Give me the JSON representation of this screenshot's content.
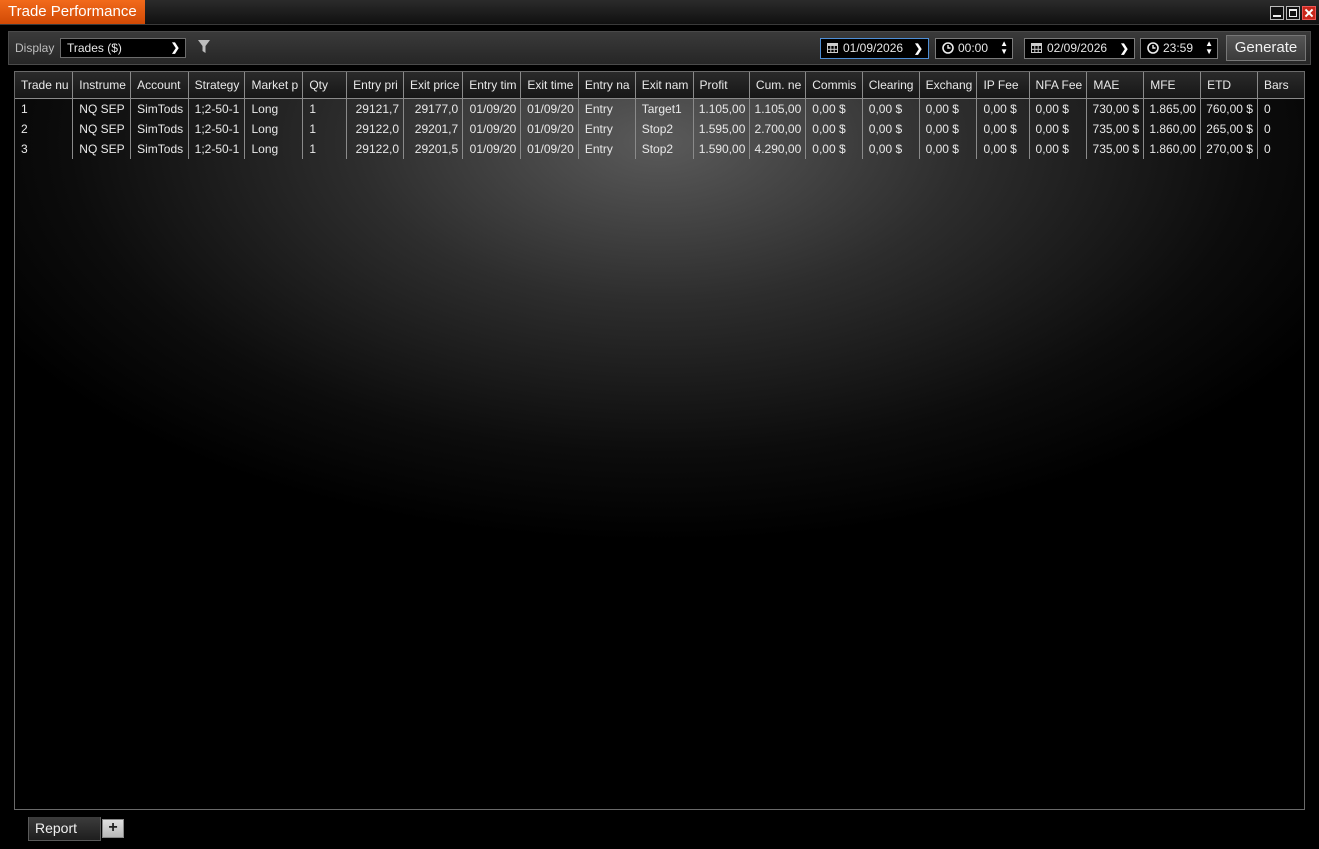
{
  "window": {
    "title": "Trade Performance"
  },
  "toolbar": {
    "display_label": "Display",
    "display_value": "Trades ($)",
    "from_date": "01/09/2026",
    "from_time": "00:00",
    "to_date": "02/09/2026",
    "to_time": "23:59",
    "generate_label": "Generate"
  },
  "grid": {
    "columns": [
      "Trade nu",
      "Instrume",
      "Account",
      "Strategy",
      "Market p",
      "Qty",
      "Entry pri",
      "Exit price",
      "Entry tim",
      "Exit time",
      "Entry na",
      "Exit nam",
      "Profit",
      "Cum. ne",
      "Commis",
      "Clearing",
      "Exchang",
      "IP Fee",
      "NFA Fee",
      "MAE",
      "MFE",
      "ETD",
      "Bars"
    ],
    "rows": [
      [
        "1",
        "NQ SEP",
        "SimTods",
        "1;2-50-1",
        "Long",
        "1",
        "29121,7",
        "29177,0",
        "01/09/20",
        "01/09/20",
        "Entry",
        "Target1",
        "1.105,00",
        "1.105,00",
        "0,00 $",
        "0,00 $",
        "0,00 $",
        "0,00 $",
        "0,00 $",
        "730,00 $",
        "1.865,00",
        "760,00 $",
        "0"
      ],
      [
        "2",
        "NQ SEP",
        "SimTods",
        "1;2-50-1",
        "Long",
        "1",
        "29122,0",
        "29201,7",
        "01/09/20",
        "01/09/20",
        "Entry",
        "Stop2",
        "1.595,00",
        "2.700,00",
        "0,00 $",
        "0,00 $",
        "0,00 $",
        "0,00 $",
        "0,00 $",
        "735,00 $",
        "1.860,00",
        "265,00 $",
        "0"
      ],
      [
        "3",
        "NQ SEP",
        "SimTods",
        "1;2-50-1",
        "Long",
        "1",
        "29122,0",
        "29201,5",
        "01/09/20",
        "01/09/20",
        "Entry",
        "Stop2",
        "1.590,00",
        "4.290,00",
        "0,00 $",
        "0,00 $",
        "0,00 $",
        "0,00 $",
        "0,00 $",
        "735,00 $",
        "1.860,00",
        "270,00 $",
        "0"
      ]
    ]
  },
  "tabs": {
    "report_label": "Report",
    "add_label": "+"
  }
}
